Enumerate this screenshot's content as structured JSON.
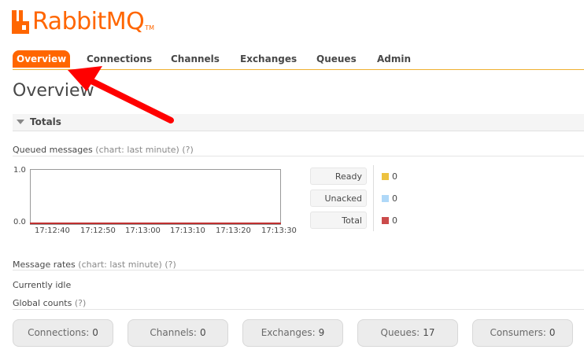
{
  "logo": {
    "text": "RabbitMQ",
    "tm": "TM"
  },
  "nav": {
    "items": [
      {
        "label": "Overview",
        "active": true
      },
      {
        "label": "Connections"
      },
      {
        "label": "Channels"
      },
      {
        "label": "Exchanges"
      },
      {
        "label": "Queues"
      },
      {
        "label": "Admin"
      }
    ]
  },
  "page_title": "Overview",
  "totals": {
    "header": "Totals",
    "queued": {
      "title": "Queued messages",
      "hint": "(chart: last minute)",
      "help": "(?)"
    },
    "chart": {
      "y_labels": [
        "1.0",
        "0.0"
      ],
      "x_ticks": [
        "17:12:40",
        "17:12:50",
        "17:13:00",
        "17:13:10",
        "17:13:20",
        "17:13:30"
      ]
    },
    "legend": [
      {
        "label": "Ready",
        "value": "0",
        "color": "#edc240"
      },
      {
        "label": "Unacked",
        "value": "0",
        "color": "#afd8f8"
      },
      {
        "label": "Total",
        "value": "0",
        "color": "#cb4b4b"
      }
    ],
    "rates": {
      "title": "Message rates",
      "hint": "(chart: last minute)",
      "help": "(?)"
    },
    "idle": "Currently idle",
    "global": {
      "title": "Global counts",
      "help": "(?)"
    },
    "counts": [
      {
        "label": "Connections:",
        "value": "0"
      },
      {
        "label": "Channels:",
        "value": "0"
      },
      {
        "label": "Exchanges:",
        "value": "9"
      },
      {
        "label": "Queues:",
        "value": "17"
      },
      {
        "label": "Consumers:",
        "value": "0"
      }
    ]
  },
  "colors": {
    "brand": "#ff6600",
    "arrow": "#ff0000"
  }
}
